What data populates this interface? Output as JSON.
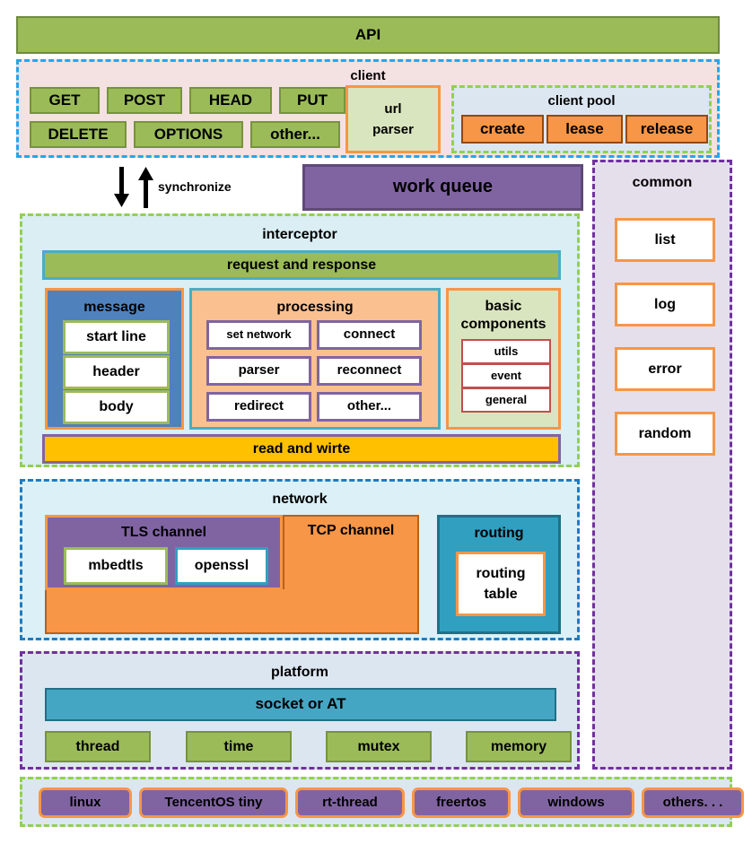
{
  "api": {
    "label": "API"
  },
  "client": {
    "title": "client",
    "methods": [
      {
        "label": "GET"
      },
      {
        "label": "POST"
      },
      {
        "label": "HEAD"
      },
      {
        "label": "PUT"
      },
      {
        "label": "DELETE"
      },
      {
        "label": "OPTIONS"
      },
      {
        "label": "other..."
      }
    ],
    "url_parser": {
      "line1": "url",
      "line2": "parser"
    },
    "pool": {
      "title": "client pool",
      "items": [
        {
          "label": "create"
        },
        {
          "label": "lease"
        },
        {
          "label": "release"
        }
      ]
    }
  },
  "sync": {
    "label": "synchronize",
    "down_arrow": "arrow-down-icon",
    "up_arrow": "arrow-up-icon"
  },
  "work_queue": {
    "label": "work queue"
  },
  "common": {
    "title": "common",
    "items": [
      {
        "label": "list"
      },
      {
        "label": "log"
      },
      {
        "label": "error"
      },
      {
        "label": "random"
      }
    ]
  },
  "interceptor": {
    "title": "interceptor",
    "request_response": "request  and  response",
    "message": {
      "title": "message",
      "items": [
        {
          "label": "start line"
        },
        {
          "label": "header"
        },
        {
          "label": "body"
        }
      ]
    },
    "processing": {
      "title": "processing",
      "items": [
        {
          "label": "set network"
        },
        {
          "label": "connect"
        },
        {
          "label": "parser"
        },
        {
          "label": "reconnect"
        },
        {
          "label": "redirect"
        },
        {
          "label": "other..."
        }
      ]
    },
    "basic_components": {
      "title": "basic components",
      "items": [
        {
          "label": "utils"
        },
        {
          "label": "event"
        },
        {
          "label": "general"
        }
      ]
    },
    "read_write": "read  and  wirte"
  },
  "network": {
    "title": "network",
    "tls": {
      "title": "TLS channel",
      "items": [
        {
          "label": "mbedtls"
        },
        {
          "label": "openssl"
        }
      ]
    },
    "tcp": {
      "title": "TCP channel"
    },
    "routing": {
      "title": "routing",
      "table_line1": "routing",
      "table_line2": "table"
    }
  },
  "platform": {
    "title": "platform",
    "socket": "socket or AT",
    "items": [
      {
        "label": "thread"
      },
      {
        "label": "time"
      },
      {
        "label": "mutex"
      },
      {
        "label": "memory"
      }
    ]
  },
  "os": {
    "items": [
      {
        "label": "linux"
      },
      {
        "label": "TencentOS tiny"
      },
      {
        "label": "rt-thread"
      },
      {
        "label": "freertos"
      },
      {
        "label": "windows"
      },
      {
        "label": "others. . ."
      }
    ]
  },
  "colors": {
    "green": "#9BBB59",
    "orange": "#F79646",
    "purple": "#8064A2",
    "blue": "#4F81BD",
    "teal": "#4BACC6",
    "peach": "#FAC090",
    "yellow": "#FFC000",
    "pink_bg": "#F4E1E1",
    "lightblue_bg": "#DAEEF3",
    "cyan_dash": "#22A7F0",
    "lavender_bg": "#E5DFEC",
    "red_border": "#C0504D"
  }
}
